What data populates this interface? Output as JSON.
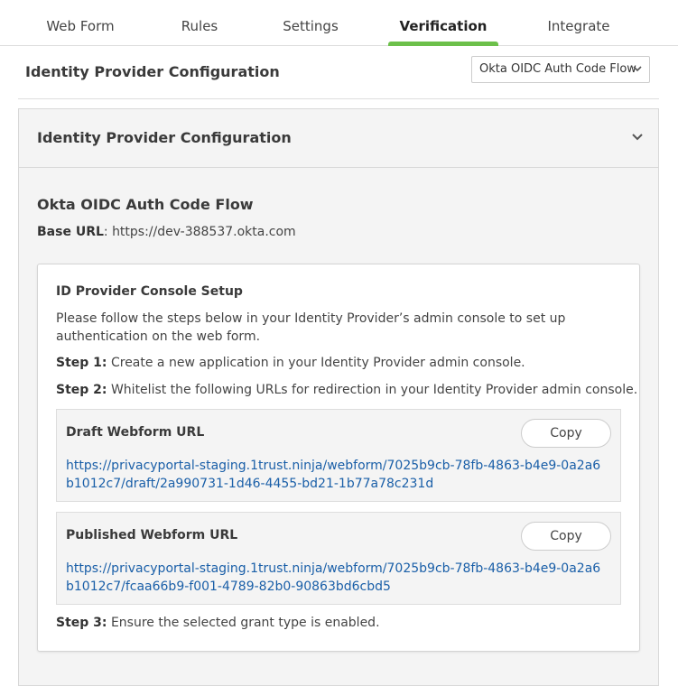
{
  "tabs": [
    {
      "label": "Web Form"
    },
    {
      "label": "Rules"
    },
    {
      "label": "Settings"
    },
    {
      "label": "Verification"
    },
    {
      "label": "Integrate"
    }
  ],
  "active_tab": "Verification",
  "header": {
    "title": "Identity Provider Configuration",
    "select_value": "Okta OIDC Auth Code Flow"
  },
  "panel": {
    "title": "Identity Provider Configuration",
    "flow_title": "Okta OIDC Auth Code Flow",
    "base_url_label": "Base URL",
    "base_url_sep": ": ",
    "base_url": "https://dev-388537.okta.com"
  },
  "setup": {
    "title": "ID Provider Console Setup",
    "intro": "Please follow the steps below in your Identity Provider’s admin console to set up authentication on the web form.",
    "step1_label": "Step 1:",
    "step1_text": " Create a new application in your Identity Provider admin console.",
    "step2_label": "Step 2:",
    "step2_text": " Whitelist the following URLs for redirection in your Identity Provider admin console.",
    "step3_label": "Step 3:",
    "step3_text": " Ensure the selected grant type is enabled."
  },
  "urls": {
    "draft_label": "Draft Webform URL",
    "draft_url": "https://privacyportal-staging.1trust.ninja/webform/7025b9cb-78fb-4863-b4e9-0a2a6b1012c7/draft/2a990731-1d46-4455-bd21-1b77a78c231d",
    "published_label": "Published Webform URL",
    "published_url": "https://privacyportal-staging.1trust.ninja/webform/7025b9cb-78fb-4863-b4e9-0a2a6b1012c7/fcaa66b9-f001-4789-82b0-90863bd6cbd5",
    "copy_label": "Copy"
  },
  "colors": {
    "accent": "#6cc04a",
    "link": "#1a5fa8"
  },
  "icons": {
    "select_chevron": "chevron-down-icon",
    "panel_chevron": "chevron-down-icon"
  }
}
